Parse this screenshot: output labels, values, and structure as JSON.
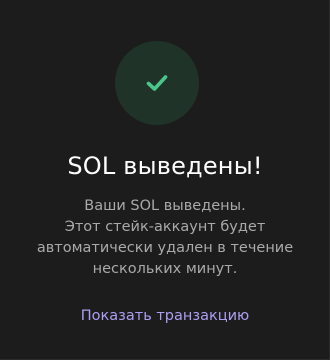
{
  "status": {
    "icon": "checkmark-icon",
    "accent_color": "#4ac68a",
    "circle_color": "#1f3329"
  },
  "title": "SOL выведены!",
  "message": {
    "lines": [
      "Ваши SOL выведены.",
      "Этот стейк-аккаунт будет",
      "автоматически удален в течение",
      "нескольких минут."
    ]
  },
  "link": {
    "label": "Показать транзакцию",
    "color": "#ab9ff2"
  }
}
